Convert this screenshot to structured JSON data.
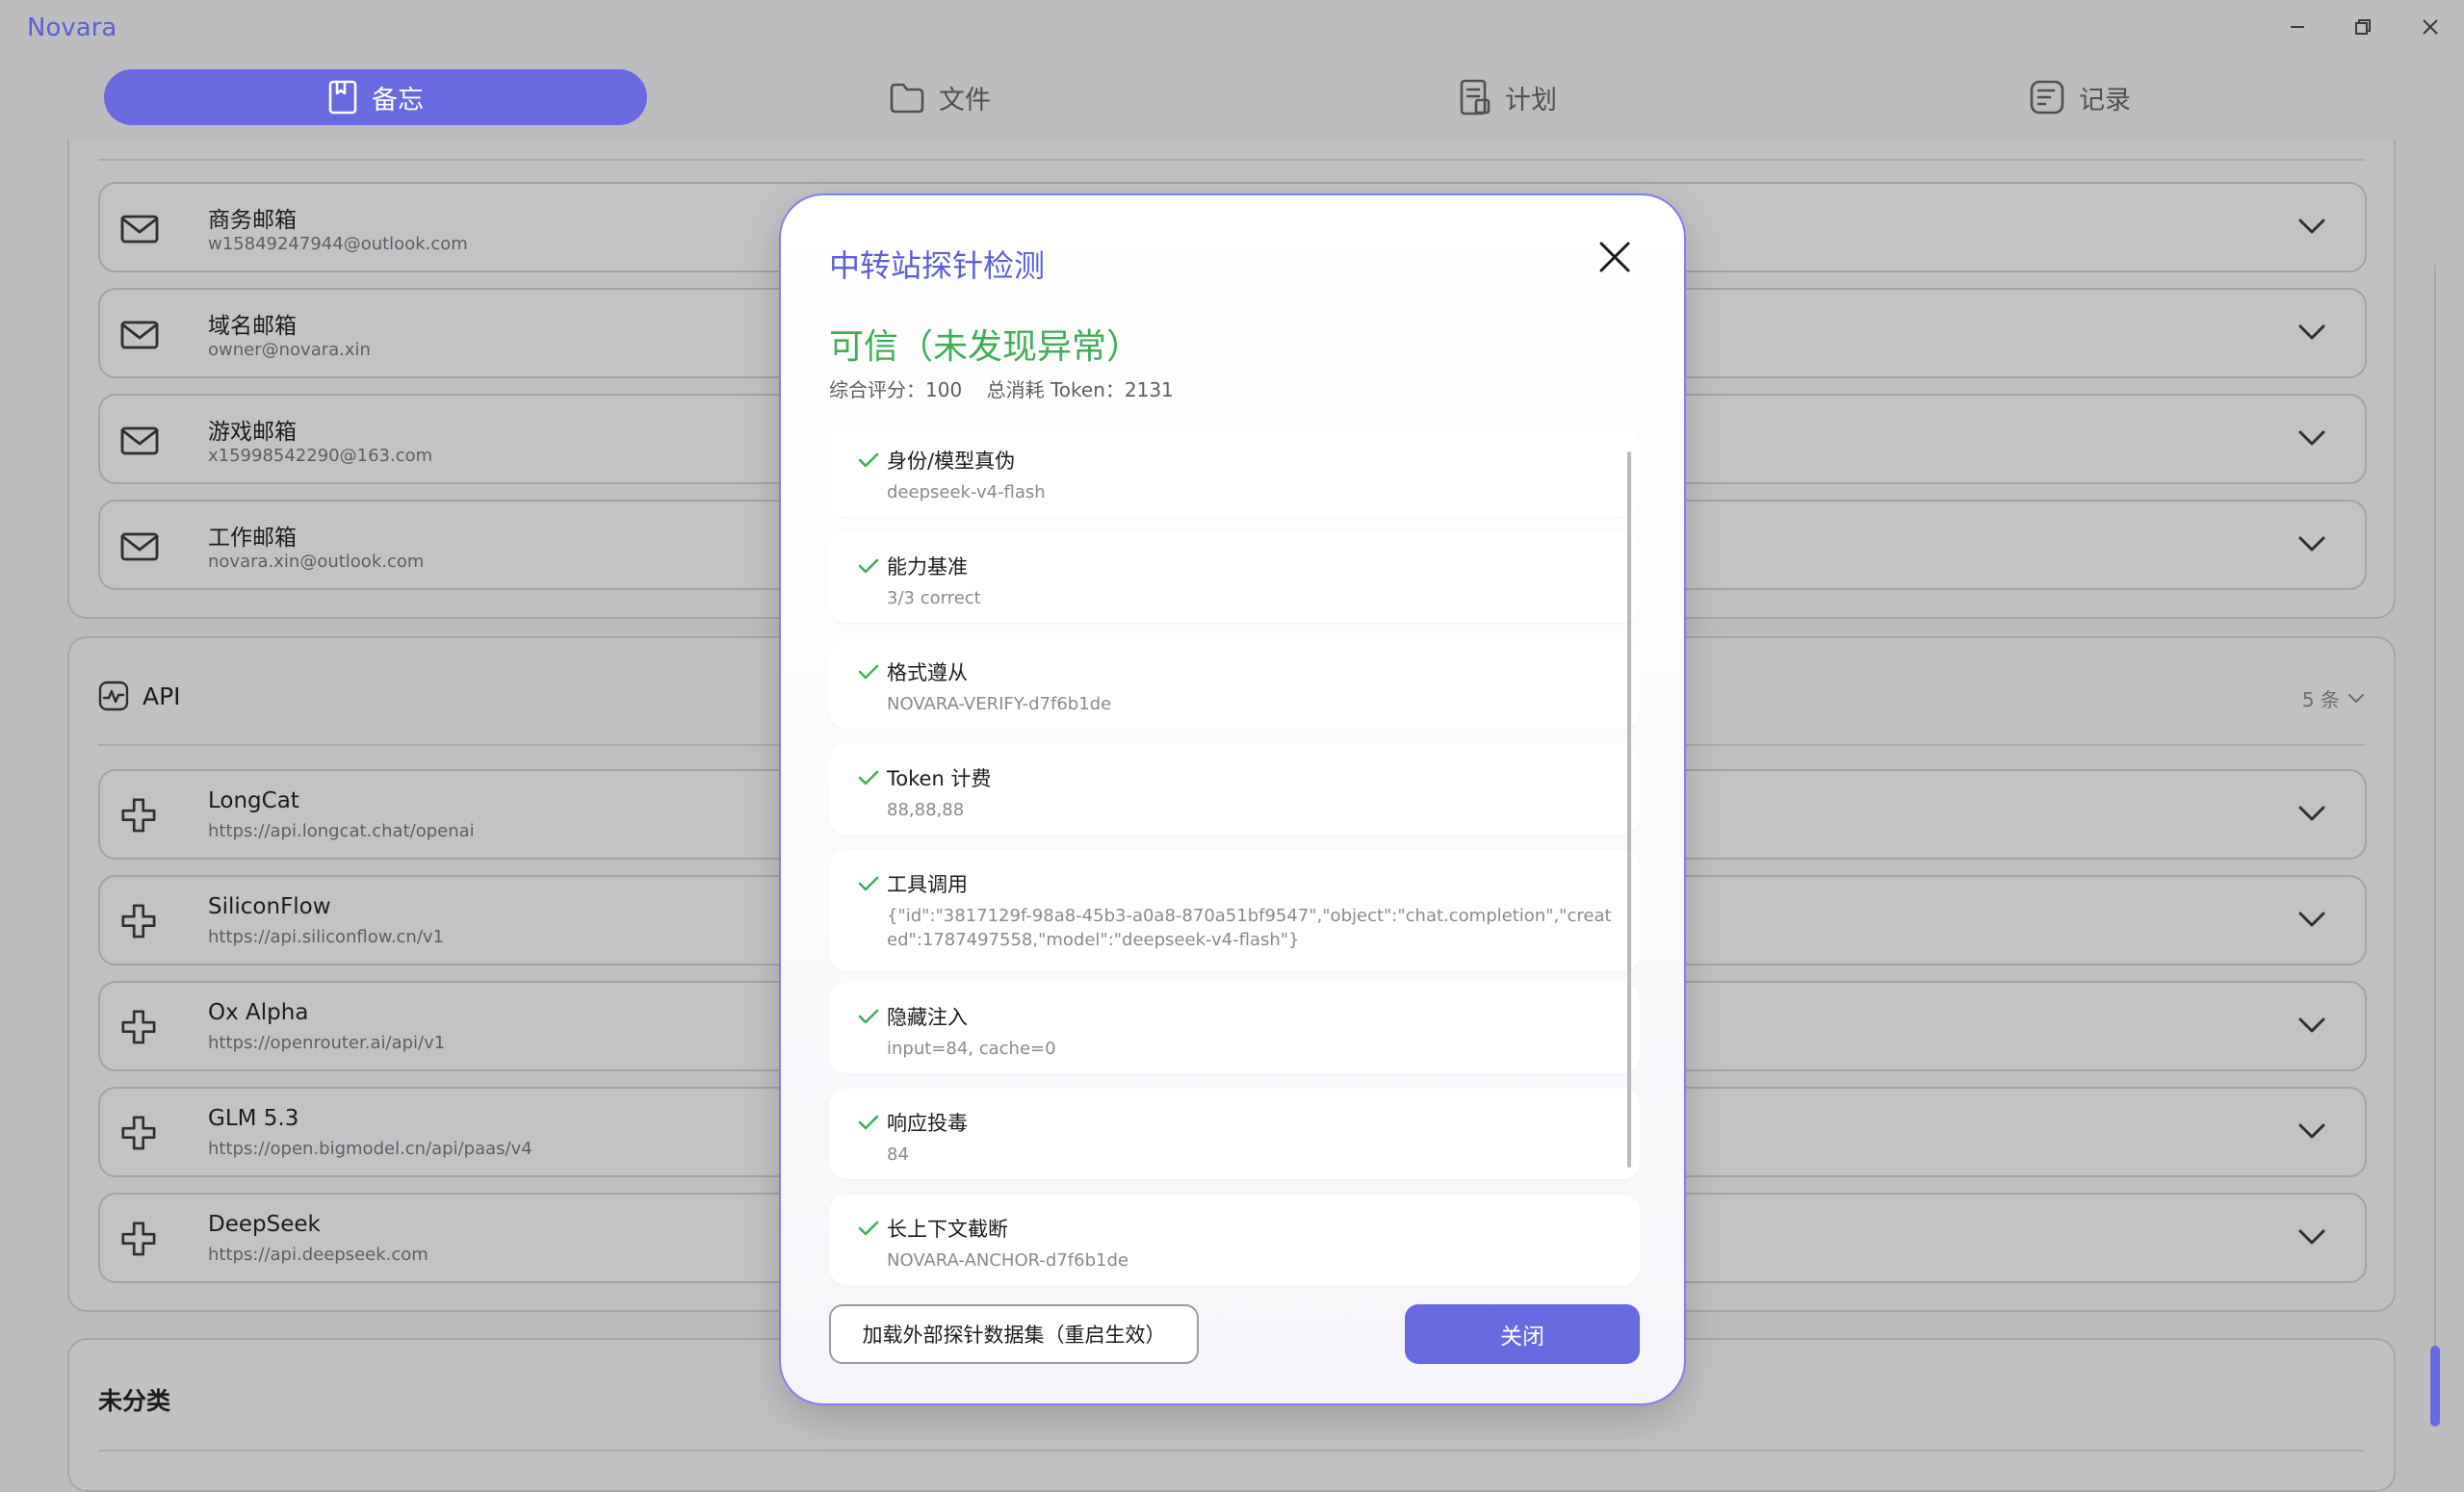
{
  "app": {
    "title": "Novara"
  },
  "window_controls": [
    {
      "name": "minimize-button",
      "icon": "minimize-icon"
    },
    {
      "name": "restore-button",
      "icon": "restore-icon"
    },
    {
      "name": "close-window-button",
      "icon": "close-icon"
    }
  ],
  "tabs": [
    {
      "label": "备忘",
      "icon": "book-icon",
      "active": true
    },
    {
      "label": "文件",
      "icon": "folder-icon",
      "active": false
    },
    {
      "label": "计划",
      "icon": "document-icon",
      "active": false
    },
    {
      "label": "记录",
      "icon": "notes-icon",
      "active": false
    }
  ],
  "email_entries": [
    {
      "name": "商务邮箱",
      "sub": "w15849247944@outlook.com"
    },
    {
      "name": "域名邮箱",
      "sub": "owner@novara.xin"
    },
    {
      "name": "游戏邮箱",
      "sub": "x15998542290@163.com"
    },
    {
      "name": "工作邮箱",
      "sub": "novara.xin@outlook.com"
    }
  ],
  "api_section": {
    "title": "API",
    "count": "5 条",
    "entries": [
      {
        "name": "LongCat",
        "sub": "https://api.longcat.chat/openai"
      },
      {
        "name": "SiliconFlow",
        "sub": "https://api.siliconflow.cn/v1"
      },
      {
        "name": "Ox Alpha",
        "sub": "https://openrouter.ai/api/v1"
      },
      {
        "name": "GLM 5.3",
        "sub": "https://open.bigmodel.cn/api/paas/v4"
      },
      {
        "name": "DeepSeek",
        "sub": "https://api.deepseek.com"
      }
    ]
  },
  "uncategorized": {
    "title": "未分类"
  },
  "dialog": {
    "title": "中转站探针检测",
    "verdict": "可信（未发现异常）",
    "summary": "综合评分：100    总消耗 Token：2131",
    "checks": [
      {
        "label": "身份/模型真伪",
        "detail": "deepseek-v4-flash"
      },
      {
        "label": "能力基准",
        "detail": "3/3 correct"
      },
      {
        "label": "格式遵从",
        "detail": "NOVARA-VERIFY-d7f6b1de"
      },
      {
        "label": "Token 计费",
        "detail": "88,88,88"
      },
      {
        "label": "工具调用",
        "detail": "{\"id\":\"3817129f-98a8-45b3-a0a8-870a51bf9547\",\"object\":\"chat.completion\",\"created\":1787497558,\"model\":\"deepseek-v4-flash\"}"
      },
      {
        "label": "隐藏注入",
        "detail": "input=84, cache=0"
      },
      {
        "label": "响应投毒",
        "detail": "84"
      },
      {
        "label": "长上下文截断",
        "detail": "NOVARA-ANCHOR-d7f6b1de"
      }
    ],
    "load_button": "加载外部探针数据集（重启生效）",
    "close_button": "关闭"
  },
  "colors": {
    "accent": "#6a6ae0",
    "brand_title": "#5b5fd6",
    "success": "#3fae57",
    "overlay_background": "#bdbdbf"
  }
}
